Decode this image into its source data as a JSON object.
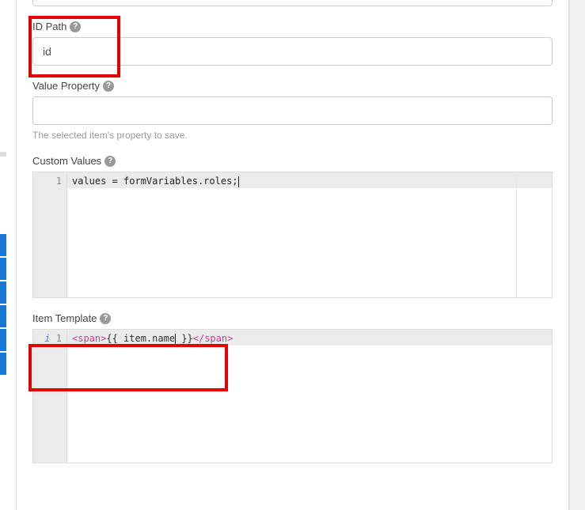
{
  "fields": {
    "idPath": {
      "label": "ID Path",
      "value": "id"
    },
    "valueProperty": {
      "label": "Value Property",
      "value": "",
      "helpText": "The selected item's property to save."
    },
    "customValues": {
      "label": "Custom Values"
    },
    "itemTemplate": {
      "label": "Item Template"
    }
  },
  "editors": {
    "customValues": {
      "lineNumber": "1",
      "code": "values = formVariables.roles;"
    },
    "itemTemplate": {
      "lineNumber": "1",
      "openTag": "<span>",
      "expr": "{{ item.name",
      "exprEnd": " }}",
      "closeTag": "</span>"
    }
  }
}
